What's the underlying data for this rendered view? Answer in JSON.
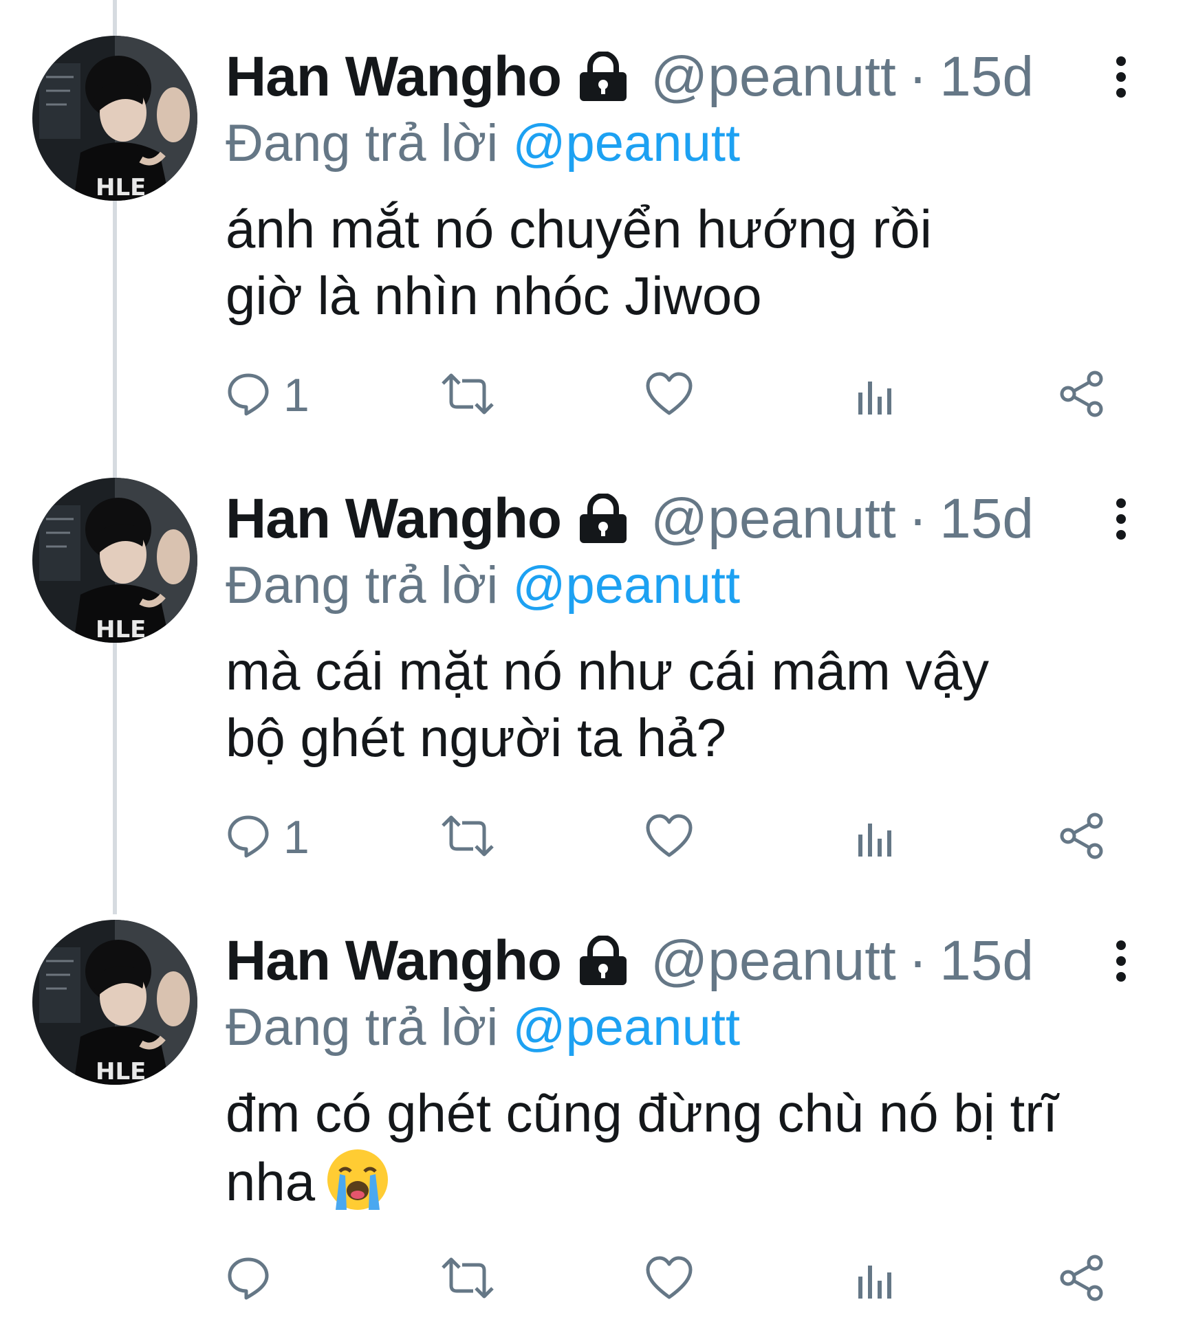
{
  "tweets": [
    {
      "author_name": "Han Wangho",
      "handle": "@peanutt",
      "separator": "·",
      "time": "15d",
      "replying_prefix": "Đang trả lời",
      "replying_to": "@peanutt",
      "text_lines": [
        "ánh mắt nó chuyển hướng rồi",
        "giờ là nhìn nhóc Jiwoo"
      ],
      "reply_count": "1"
    },
    {
      "author_name": "Han Wangho",
      "handle": "@peanutt",
      "separator": "·",
      "time": "15d",
      "replying_prefix": "Đang trả lời",
      "replying_to": "@peanutt",
      "text_lines": [
        "mà cái mặt nó như cái mâm vậy",
        "bộ ghét người ta hả?"
      ],
      "reply_count": "1"
    },
    {
      "author_name": "Han Wangho",
      "handle": "@peanutt",
      "separator": "·",
      "time": "15d",
      "replying_prefix": "Đang trả lời",
      "replying_to": "@peanutt",
      "text_lines": [
        "đm có ghét cũng đừng chù nó bị trĩ",
        "nha"
      ],
      "emoji": "loudly-crying-face",
      "reply_count": ""
    }
  ],
  "avatar_text": "HLE",
  "icons": {
    "lock": "lock-icon",
    "more": "more-vertical-icon",
    "reply": "reply-icon",
    "retweet": "retweet-icon",
    "like": "heart-icon",
    "analytics": "analytics-icon",
    "share": "share-icon"
  },
  "colors": {
    "text": "#14171a",
    "secondary": "#657786",
    "mention": "#1da1f2",
    "thread_line": "#d6dbe0"
  }
}
